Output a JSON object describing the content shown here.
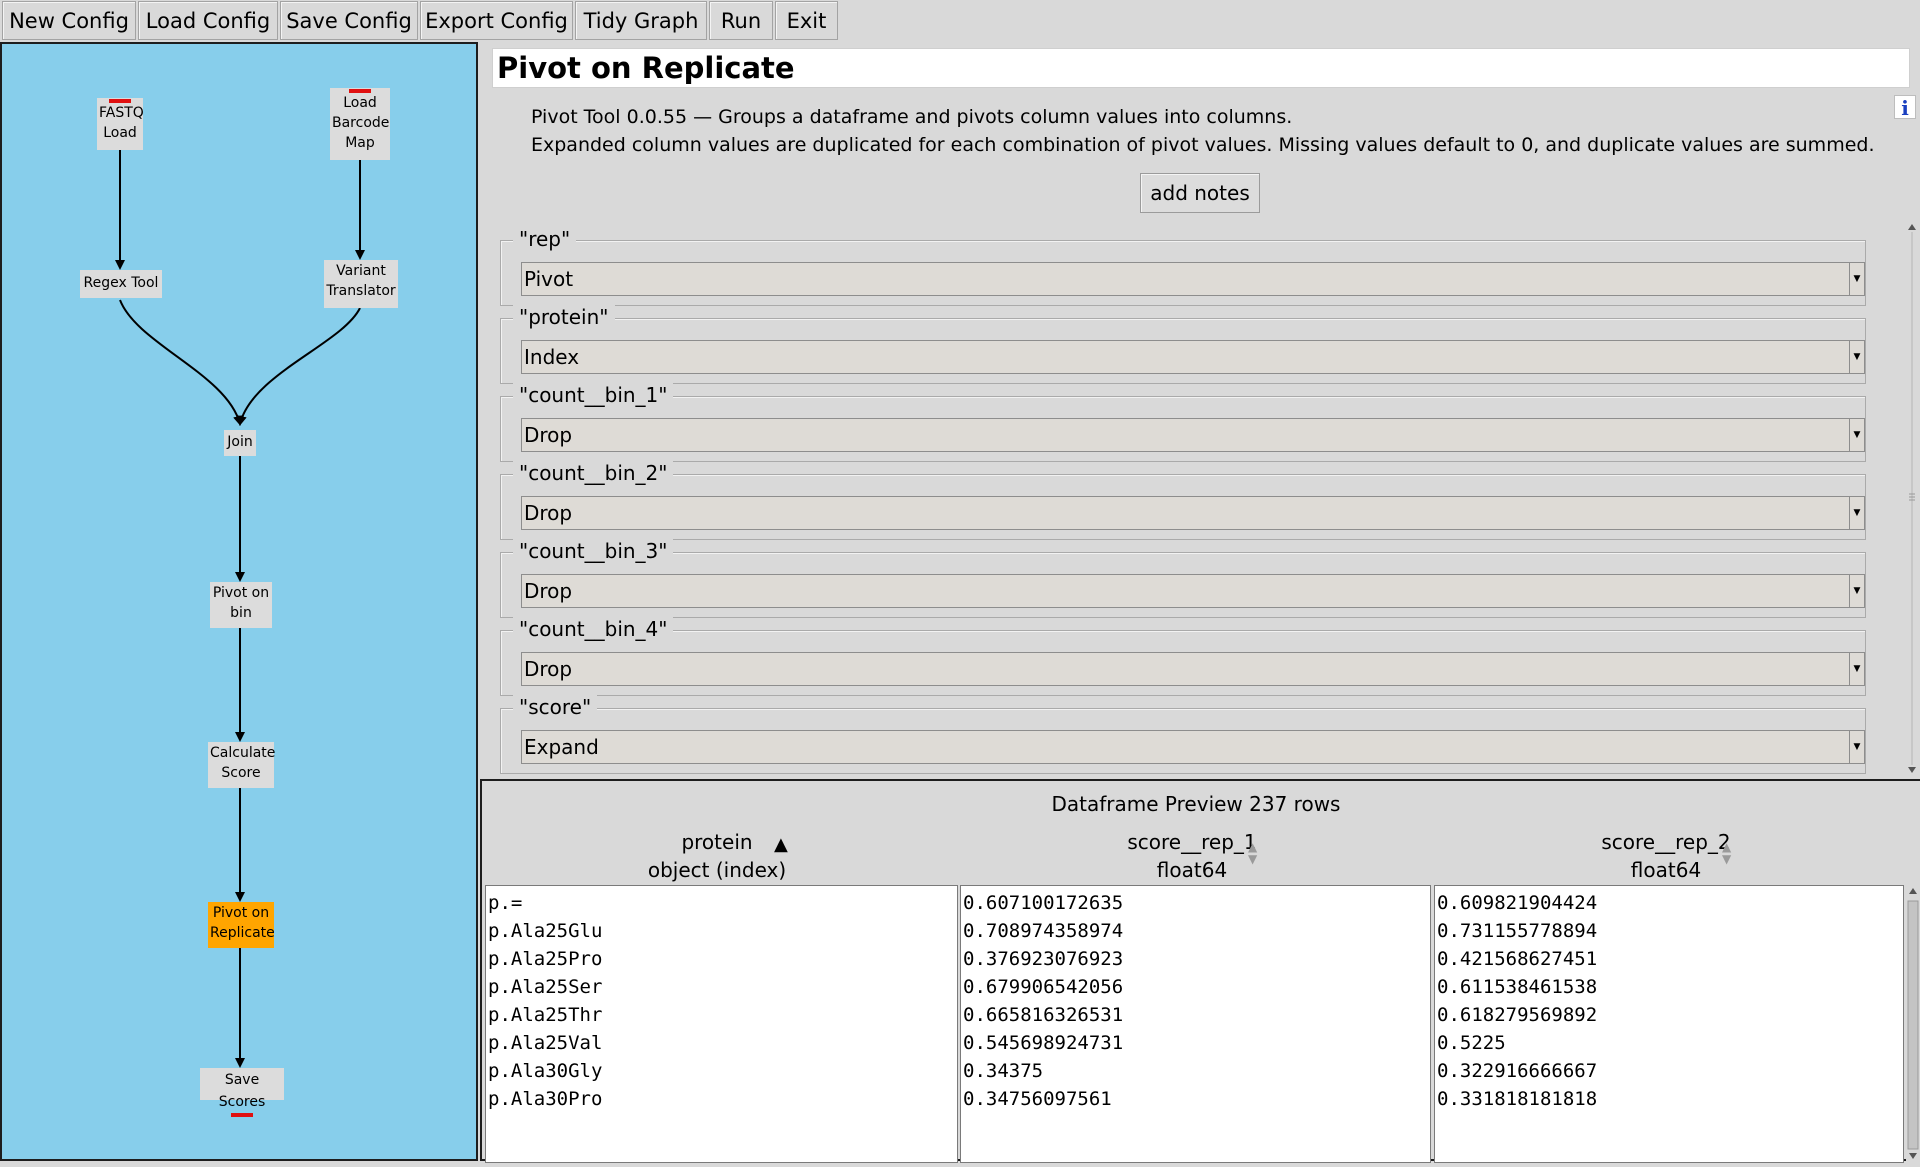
{
  "toolbar": {
    "buttons": [
      "New Config",
      "Load Config",
      "Save Config",
      "Export Config",
      "Tidy Graph",
      "Run",
      "Exit"
    ]
  },
  "graph": {
    "nodes": {
      "fastq_load": "FASTQ\nLoad",
      "load_barcode_map": "Load\nBarcode\nMap",
      "regex_tool": "Regex Tool",
      "variant_translator": "Variant\nTranslator",
      "join": "Join",
      "pivot_on_bin": "Pivot on\nbin",
      "calculate_score": "Calculate\nScore",
      "pivot_on_replicate": "Pivot on\nReplicate",
      "save_scores": "Save Scores"
    },
    "colors": {
      "background": "#87ceeb",
      "active_node": "#ffa500",
      "node": "#dcdcdc",
      "port": "#e01010"
    }
  },
  "config": {
    "title": "Pivot on Replicate",
    "info_icon": "i",
    "description_line1": "Pivot Tool 0.0.55 — Groups a dataframe and pivots column values into columns.",
    "description_line2": "Expanded column values are duplicated for each combination of pivot values. Missing values default to 0, and duplicate values are summed.",
    "add_notes_label": "add notes",
    "fields": [
      {
        "label": "\"rep\"",
        "value": "Pivot"
      },
      {
        "label": "\"protein\"",
        "value": "Index"
      },
      {
        "label": "\"count__bin_1\"",
        "value": "Drop"
      },
      {
        "label": "\"count__bin_2\"",
        "value": "Drop"
      },
      {
        "label": "\"count__bin_3\"",
        "value": "Drop"
      },
      {
        "label": "\"count__bin_4\"",
        "value": "Drop"
      },
      {
        "label": "\"score\"",
        "value": "Expand"
      }
    ]
  },
  "preview": {
    "title": "Dataframe Preview 237 rows",
    "columns": [
      {
        "name": "protein",
        "dtype": "object (index)",
        "sort": "ascending",
        "values": [
          "p.=",
          "p.Ala25Glu",
          "p.Ala25Pro",
          "p.Ala25Ser",
          "p.Ala25Thr",
          "p.Ala25Val",
          "p.Ala30Gly",
          "p.Ala30Pro"
        ]
      },
      {
        "name": "score__rep_1",
        "dtype": "float64",
        "sort": "none",
        "values": [
          "0.607100172635",
          "0.708974358974",
          "0.376923076923",
          "0.679906542056",
          "0.665816326531",
          "0.545698924731",
          "0.34375",
          "0.34756097561"
        ]
      },
      {
        "name": "score__rep_2",
        "dtype": "float64",
        "sort": "none",
        "values": [
          "0.609821904424",
          "0.731155778894",
          "0.421568627451",
          "0.611538461538",
          "0.618279569892",
          "0.5225",
          "0.322916666667",
          "0.331818181818"
        ]
      }
    ]
  }
}
